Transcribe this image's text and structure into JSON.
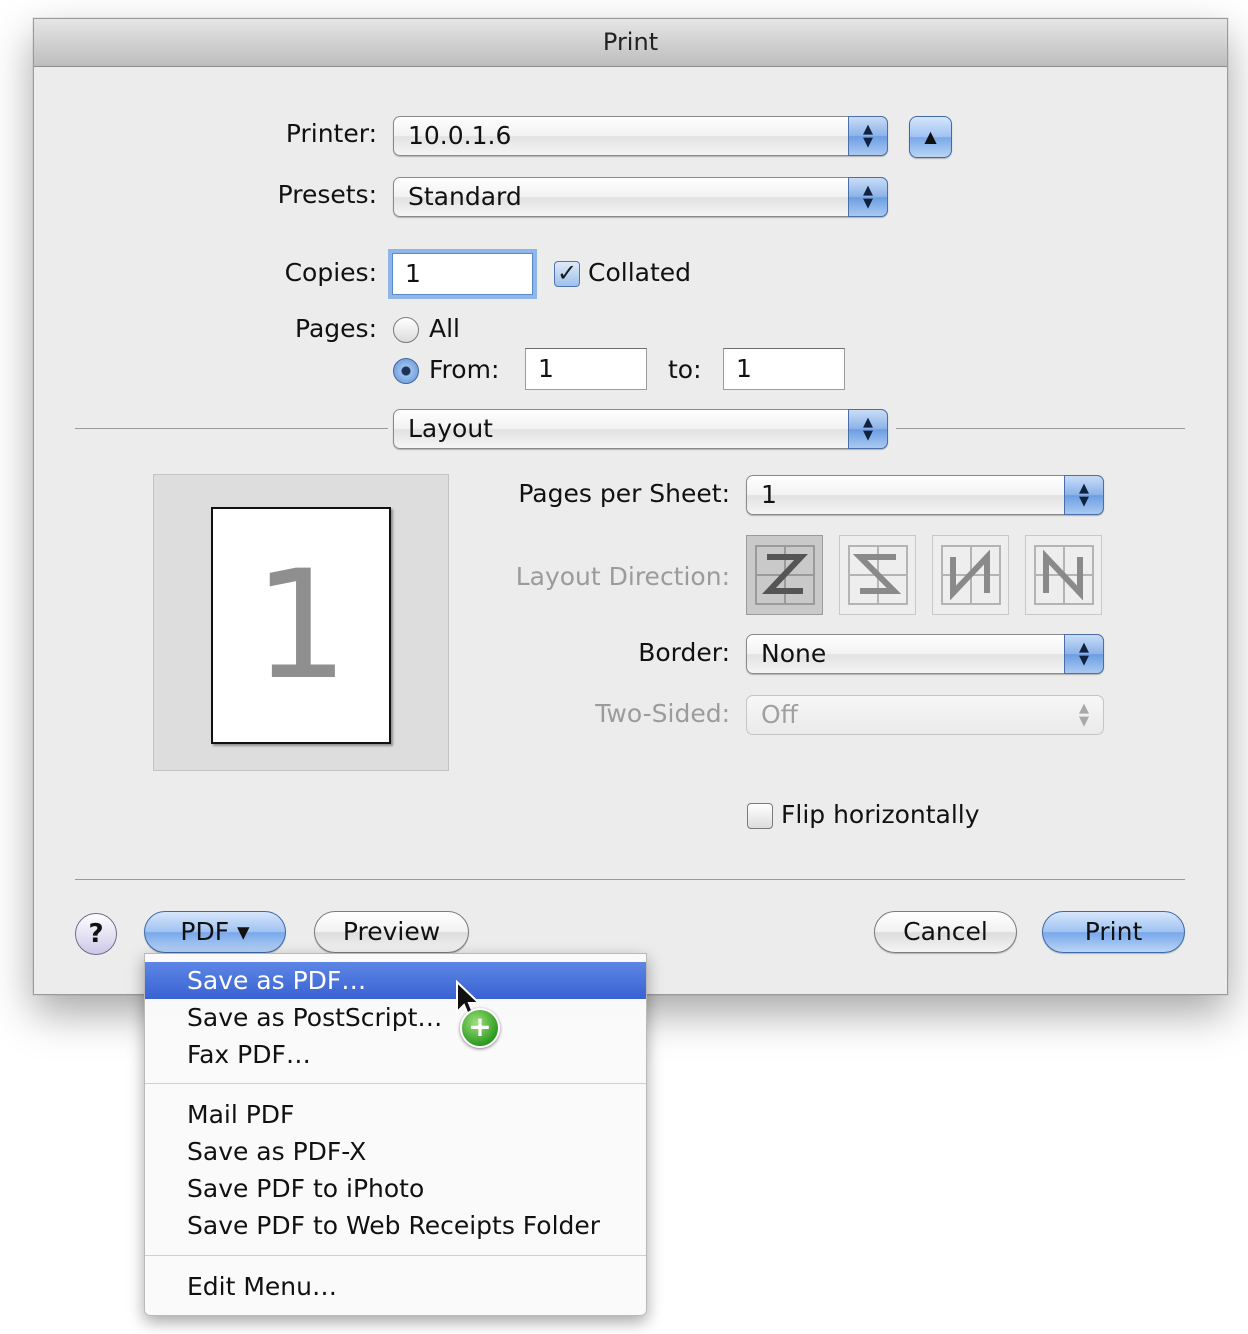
{
  "window": {
    "title": "Print"
  },
  "printer": {
    "label": "Printer:",
    "value": "10.0.1.6"
  },
  "presets": {
    "label": "Presets:",
    "value": "Standard"
  },
  "copies": {
    "label": "Copies:",
    "value": "1",
    "collated_label": "Collated",
    "collated": true
  },
  "pages": {
    "label": "Pages:",
    "all_label": "All",
    "from_label": "From:",
    "from_value": "1",
    "to_label": "to:",
    "to_value": "1",
    "selected": "from"
  },
  "section_popup": {
    "value": "Layout"
  },
  "layout": {
    "preview_page_number": "1",
    "pages_per_sheet_label": "Pages per Sheet:",
    "pages_per_sheet_value": "1",
    "layout_direction_label": "Layout Direction:",
    "layout_directions": [
      "z-order-icon",
      "s-order-icon",
      "reverse-n-order-icon",
      "n-order-icon"
    ],
    "selected_direction": "z-order-icon",
    "border_label": "Border:",
    "border_value": "None",
    "two_sided_label": "Two-Sided:",
    "two_sided_value": "Off",
    "flip_label": "Flip horizontally",
    "flip": false
  },
  "buttons": {
    "help": "?",
    "pdf": "PDF ▾",
    "preview": "Preview",
    "cancel": "Cancel",
    "print": "Print"
  },
  "pdf_menu": {
    "items": [
      "Save as PDF…",
      "Save as PostScript…",
      "Fax PDF…",
      "Mail PDF",
      "Save as PDF-X",
      "Save PDF to iPhoto",
      "Save PDF to Web Receipts Folder",
      "Edit Menu…"
    ],
    "highlighted_index": 0
  },
  "cursor_badge": "+",
  "colors": {
    "accent": "#3a62d3",
    "window_bg": "#ececec",
    "disabled_text": "#9b9b9b"
  }
}
